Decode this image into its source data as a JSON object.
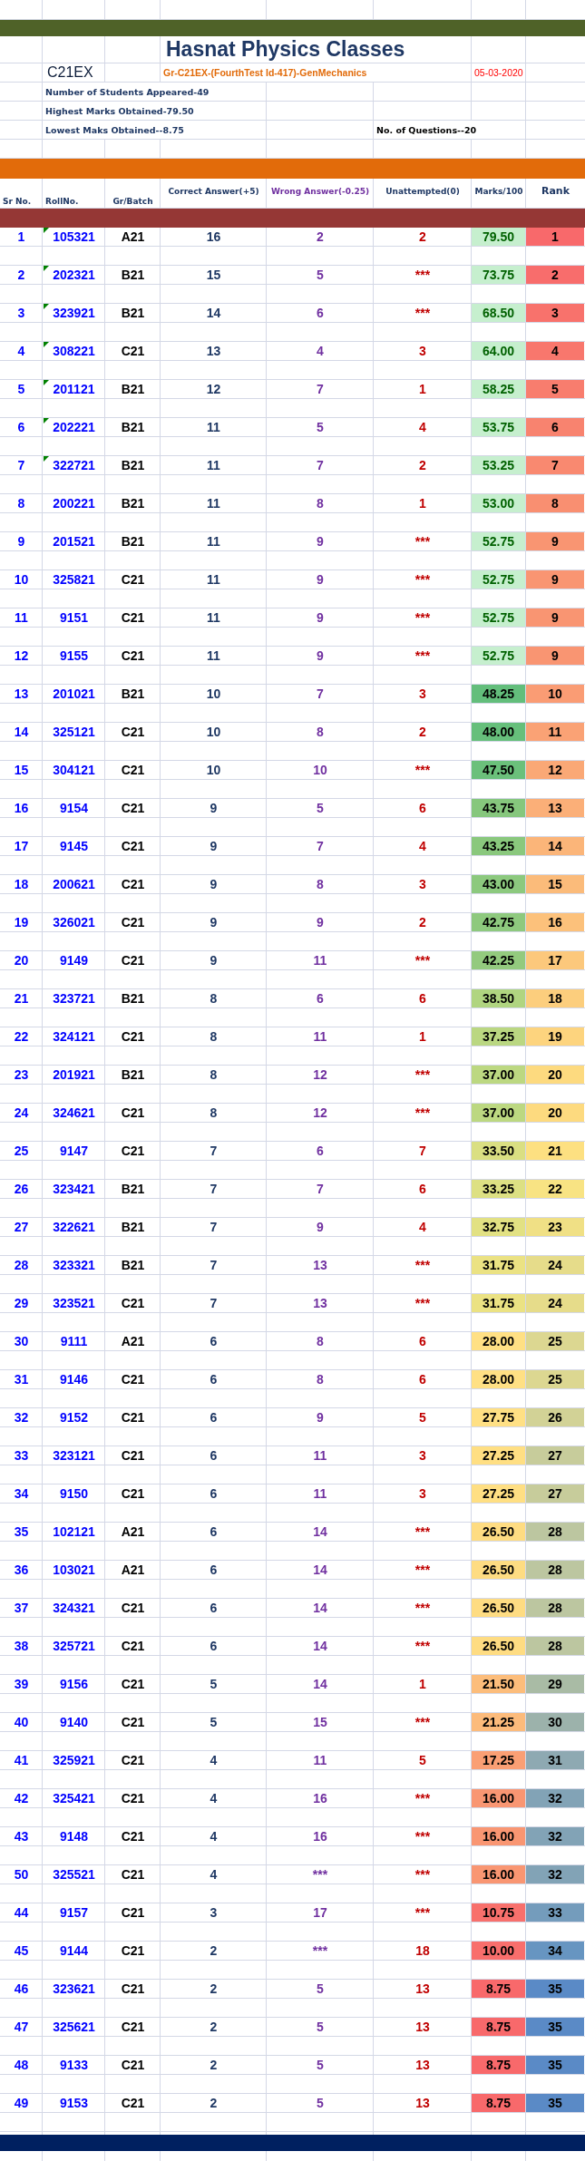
{
  "title": "Hasnat Physics Classes",
  "class_code": "C21EX",
  "test_name": "Gr-C21EX-(FourthTest Id-417)-GenMechanics",
  "date": "05-03-2020",
  "stats": [
    "Number of Students Appeared-49",
    "Highest Marks Obtained-79.50",
    "Lowest Maks Obtained--8.75"
  ],
  "questions": "No. of Questions--20",
  "columns": [
    "Sr No.",
    "RollNo.",
    "Gr/Batch",
    "Correct Answer(+5)",
    "Wrong Answer(-0.25)",
    "Unattempted(0)",
    "Marks/100",
    "Rank"
  ],
  "rows": [
    {
      "sr": "1",
      "roll": "105321",
      "batch": "A21",
      "correct": "16",
      "wrong": "2",
      "unattempted": "2",
      "marks": {
        "value": "79.50",
        "color": "#c6efce",
        "good": true
      },
      "rank": {
        "value": "1",
        "color": "#f8696b"
      },
      "flagged": true
    },
    {
      "sr": "2",
      "roll": "202321",
      "batch": "B21",
      "correct": "15",
      "wrong": "5",
      "unattempted": "***",
      "marks": {
        "value": "73.75",
        "color": "#c6efce",
        "good": true
      },
      "rank": {
        "value": "2",
        "color": "#f86d6c"
      },
      "flagged": true
    },
    {
      "sr": "3",
      "roll": "323921",
      "batch": "B21",
      "correct": "14",
      "wrong": "6",
      "unattempted": "***",
      "marks": {
        "value": "68.50",
        "color": "#c6efce",
        "good": true
      },
      "rank": {
        "value": "3",
        "color": "#f8726c"
      },
      "flagged": true
    },
    {
      "sr": "4",
      "roll": "308221",
      "batch": "C21",
      "correct": "13",
      "wrong": "4",
      "unattempted": "3",
      "marks": {
        "value": "64.00",
        "color": "#c6efce",
        "good": true
      },
      "rank": {
        "value": "4",
        "color": "#f8776d"
      },
      "flagged": true
    },
    {
      "sr": "5",
      "roll": "201121",
      "batch": "B21",
      "correct": "12",
      "wrong": "7",
      "unattempted": "1",
      "marks": {
        "value": "58.25",
        "color": "#c6efce",
        "good": true
      },
      "rank": {
        "value": "5",
        "color": "#f87d6e"
      },
      "flagged": true
    },
    {
      "sr": "6",
      "roll": "202221",
      "batch": "B21",
      "correct": "11",
      "wrong": "5",
      "unattempted": "4",
      "marks": {
        "value": "53.75",
        "color": "#c6efce",
        "good": true
      },
      "rank": {
        "value": "6",
        "color": "#f8836f"
      },
      "flagged": true
    },
    {
      "sr": "7",
      "roll": "322721",
      "batch": "B21",
      "correct": "11",
      "wrong": "7",
      "unattempted": "2",
      "marks": {
        "value": "53.25",
        "color": "#c6efce",
        "good": true
      },
      "rank": {
        "value": "7",
        "color": "#f98970"
      },
      "flagged": true
    },
    {
      "sr": "8",
      "roll": "200221",
      "batch": "B21",
      "correct": "11",
      "wrong": "8",
      "unattempted": "1",
      "marks": {
        "value": "53.00",
        "color": "#c6efce",
        "good": true
      },
      "rank": {
        "value": "8",
        "color": "#f98f71"
      },
      "flagged": false
    },
    {
      "sr": "9",
      "roll": "201521",
      "batch": "B21",
      "correct": "11",
      "wrong": "9",
      "unattempted": "***",
      "marks": {
        "value": "52.75",
        "color": "#c6efce",
        "good": true
      },
      "rank": {
        "value": "9",
        "color": "#f99572"
      },
      "flagged": false
    },
    {
      "sr": "10",
      "roll": "325821",
      "batch": "C21",
      "correct": "11",
      "wrong": "9",
      "unattempted": "***",
      "marks": {
        "value": "52.75",
        "color": "#c6efce",
        "good": true
      },
      "rank": {
        "value": "9",
        "color": "#f99572"
      },
      "flagged": false
    },
    {
      "sr": "11",
      "roll": "9151",
      "batch": "C21",
      "correct": "11",
      "wrong": "9",
      "unattempted": "***",
      "marks": {
        "value": "52.75",
        "color": "#c6efce",
        "good": true
      },
      "rank": {
        "value": "9",
        "color": "#f99572"
      },
      "flagged": false
    },
    {
      "sr": "12",
      "roll": "9155",
      "batch": "C21",
      "correct": "11",
      "wrong": "9",
      "unattempted": "***",
      "marks": {
        "value": "52.75",
        "color": "#c6efce",
        "good": true
      },
      "rank": {
        "value": "9",
        "color": "#f99572"
      },
      "flagged": false
    },
    {
      "sr": "13",
      "roll": "201021",
      "batch": "B21",
      "correct": "10",
      "wrong": "7",
      "unattempted": "3",
      "marks": {
        "value": "48.25",
        "color": "#63be7b",
        "good": false
      },
      "rank": {
        "value": "10",
        "color": "#fa9c74"
      },
      "flagged": false
    },
    {
      "sr": "14",
      "roll": "325121",
      "batch": "C21",
      "correct": "10",
      "wrong": "8",
      "unattempted": "2",
      "marks": {
        "value": "48.00",
        "color": "#66bf7b",
        "good": false
      },
      "rank": {
        "value": "11",
        "color": "#faa275"
      },
      "flagged": false
    },
    {
      "sr": "15",
      "roll": "304121",
      "batch": "C21",
      "correct": "10",
      "wrong": "10",
      "unattempted": "***",
      "marks": {
        "value": "47.50",
        "color": "#6bc07b",
        "good": false
      },
      "rank": {
        "value": "12",
        "color": "#faa876"
      },
      "flagged": false
    },
    {
      "sr": "16",
      "roll": "9154",
      "batch": "C21",
      "correct": "9",
      "wrong": "5",
      "unattempted": "6",
      "marks": {
        "value": "43.75",
        "color": "#86c77d",
        "good": false
      },
      "rank": {
        "value": "13",
        "color": "#fbaf78"
      },
      "flagged": false
    },
    {
      "sr": "17",
      "roll": "9145",
      "batch": "C21",
      "correct": "9",
      "wrong": "7",
      "unattempted": "4",
      "marks": {
        "value": "43.25",
        "color": "#8ac87d",
        "good": false
      },
      "rank": {
        "value": "14",
        "color": "#fbb579"
      },
      "flagged": false
    },
    {
      "sr": "18",
      "roll": "200621",
      "batch": "C21",
      "correct": "9",
      "wrong": "8",
      "unattempted": "3",
      "marks": {
        "value": "43.00",
        "color": "#8cc97e",
        "good": false
      },
      "rank": {
        "value": "15",
        "color": "#fbbb7a"
      },
      "flagged": false
    },
    {
      "sr": "19",
      "roll": "326021",
      "batch": "C21",
      "correct": "9",
      "wrong": "9",
      "unattempted": "2",
      "marks": {
        "value": "42.75",
        "color": "#8ec97e",
        "good": false
      },
      "rank": {
        "value": "16",
        "color": "#fcc17b"
      },
      "flagged": false
    },
    {
      "sr": "20",
      "roll": "9149",
      "batch": "C21",
      "correct": "9",
      "wrong": "11",
      "unattempted": "***",
      "marks": {
        "value": "42.25",
        "color": "#93ca7e",
        "good": false
      },
      "rank": {
        "value": "17",
        "color": "#fcc87c"
      },
      "flagged": false
    },
    {
      "sr": "21",
      "roll": "323721",
      "batch": "B21",
      "correct": "8",
      "wrong": "6",
      "unattempted": "6",
      "marks": {
        "value": "38.50",
        "color": "#b0d580",
        "good": false
      },
      "rank": {
        "value": "18",
        "color": "#fcce7d"
      },
      "flagged": false
    },
    {
      "sr": "22",
      "roll": "324121",
      "batch": "C21",
      "correct": "8",
      "wrong": "11",
      "unattempted": "1",
      "marks": {
        "value": "37.25",
        "color": "#bad781",
        "good": false
      },
      "rank": {
        "value": "19",
        "color": "#fdd47e"
      },
      "flagged": false
    },
    {
      "sr": "23",
      "roll": "201921",
      "batch": "B21",
      "correct": "8",
      "wrong": "12",
      "unattempted": "***",
      "marks": {
        "value": "37.00",
        "color": "#bcd881",
        "good": false
      },
      "rank": {
        "value": "20",
        "color": "#fdda7f"
      },
      "flagged": false
    },
    {
      "sr": "24",
      "roll": "324621",
      "batch": "C21",
      "correct": "8",
      "wrong": "12",
      "unattempted": "***",
      "marks": {
        "value": "37.00",
        "color": "#bcd881",
        "good": false
      },
      "rank": {
        "value": "20",
        "color": "#fdda7f"
      },
      "flagged": false
    },
    {
      "sr": "25",
      "roll": "9147",
      "batch": "C21",
      "correct": "7",
      "wrong": "6",
      "unattempted": "7",
      "marks": {
        "value": "33.50",
        "color": "#dadf82",
        "good": false
      },
      "rank": {
        "value": "21",
        "color": "#fde081"
      },
      "flagged": false
    },
    {
      "sr": "26",
      "roll": "323421",
      "batch": "B21",
      "correct": "7",
      "wrong": "7",
      "unattempted": "6",
      "marks": {
        "value": "33.25",
        "color": "#dde083",
        "good": false
      },
      "rank": {
        "value": "22",
        "color": "#f8e383"
      },
      "flagged": false
    },
    {
      "sr": "27",
      "roll": "322621",
      "batch": "B21",
      "correct": "7",
      "wrong": "9",
      "unattempted": "4",
      "marks": {
        "value": "32.75",
        "color": "#e2e183",
        "good": false
      },
      "rank": {
        "value": "23",
        "color": "#f0e085"
      },
      "flagged": false
    },
    {
      "sr": "28",
      "roll": "323321",
      "batch": "B21",
      "correct": "7",
      "wrong": "13",
      "unattempted": "***",
      "marks": {
        "value": "31.75",
        "color": "#ebe283",
        "good": false
      },
      "rank": {
        "value": "24",
        "color": "#e6dc8a"
      },
      "flagged": false
    },
    {
      "sr": "29",
      "roll": "323521",
      "batch": "C21",
      "correct": "7",
      "wrong": "13",
      "unattempted": "***",
      "marks": {
        "value": "31.75",
        "color": "#ebe283",
        "good": false
      },
      "rank": {
        "value": "24",
        "color": "#e6dc8a"
      },
      "flagged": false
    },
    {
      "sr": "30",
      "roll": "9111",
      "batch": "A21",
      "correct": "6",
      "wrong": "8",
      "unattempted": "6",
      "marks": {
        "value": "28.00",
        "color": "#ffe084",
        "good": false
      },
      "rank": {
        "value": "25",
        "color": "#dcd791"
      },
      "flagged": false
    },
    {
      "sr": "31",
      "roll": "9146",
      "batch": "C21",
      "correct": "6",
      "wrong": "8",
      "unattempted": "6",
      "marks": {
        "value": "28.00",
        "color": "#ffe084",
        "good": false
      },
      "rank": {
        "value": "25",
        "color": "#dcd791"
      },
      "flagged": false
    },
    {
      "sr": "32",
      "roll": "9152",
      "batch": "C21",
      "correct": "6",
      "wrong": "9",
      "unattempted": "5",
      "marks": {
        "value": "27.75",
        "color": "#ffe084",
        "good": false
      },
      "rank": {
        "value": "26",
        "color": "#d2d296"
      },
      "flagged": false
    },
    {
      "sr": "33",
      "roll": "323121",
      "batch": "C21",
      "correct": "6",
      "wrong": "11",
      "unattempted": "3",
      "marks": {
        "value": "27.25",
        "color": "#ffdf83",
        "good": false
      },
      "rank": {
        "value": "27",
        "color": "#c7cc9b"
      },
      "flagged": false
    },
    {
      "sr": "34",
      "roll": "9150",
      "batch": "C21",
      "correct": "6",
      "wrong": "11",
      "unattempted": "3",
      "marks": {
        "value": "27.25",
        "color": "#ffdf83",
        "good": false
      },
      "rank": {
        "value": "27",
        "color": "#c7cc9b"
      },
      "flagged": false
    },
    {
      "sr": "35",
      "roll": "102121",
      "batch": "A21",
      "correct": "6",
      "wrong": "14",
      "unattempted": "***",
      "marks": {
        "value": "26.50",
        "color": "#fedc82",
        "good": false
      },
      "rank": {
        "value": "28",
        "color": "#bcc6a0"
      },
      "flagged": false
    },
    {
      "sr": "36",
      "roll": "103021",
      "batch": "A21",
      "correct": "6",
      "wrong": "14",
      "unattempted": "***",
      "marks": {
        "value": "26.50",
        "color": "#fedc82",
        "good": false
      },
      "rank": {
        "value": "28",
        "color": "#bcc6a0"
      },
      "flagged": false
    },
    {
      "sr": "37",
      "roll": "324321",
      "batch": "C21",
      "correct": "6",
      "wrong": "14",
      "unattempted": "***",
      "marks": {
        "value": "26.50",
        "color": "#fedc82",
        "good": false
      },
      "rank": {
        "value": "28",
        "color": "#bcc6a0"
      },
      "flagged": false
    },
    {
      "sr": "38",
      "roll": "325721",
      "batch": "C21",
      "correct": "6",
      "wrong": "14",
      "unattempted": "***",
      "marks": {
        "value": "26.50",
        "color": "#fedc82",
        "good": false
      },
      "rank": {
        "value": "28",
        "color": "#bcc6a0"
      },
      "flagged": false
    },
    {
      "sr": "39",
      "roll": "9156",
      "batch": "C21",
      "correct": "5",
      "wrong": "14",
      "unattempted": "1",
      "marks": {
        "value": "21.50",
        "color": "#fcbd7b",
        "good": false
      },
      "rank": {
        "value": "29",
        "color": "#a9bba5"
      },
      "flagged": false
    },
    {
      "sr": "40",
      "roll": "9140",
      "batch": "C21",
      "correct": "5",
      "wrong": "15",
      "unattempted": "***",
      "marks": {
        "value": "21.25",
        "color": "#fcbb7b",
        "good": false
      },
      "rank": {
        "value": "30",
        "color": "#9cb2ab"
      },
      "flagged": false
    },
    {
      "sr": "41",
      "roll": "325921",
      "batch": "C21",
      "correct": "4",
      "wrong": "11",
      "unattempted": "5",
      "marks": {
        "value": "17.25",
        "color": "#fa9f74",
        "good": false
      },
      "rank": {
        "value": "31",
        "color": "#8ea9b2"
      },
      "flagged": false
    },
    {
      "sr": "42",
      "roll": "325421",
      "batch": "C21",
      "correct": "4",
      "wrong": "16",
      "unattempted": "***",
      "marks": {
        "value": "16.00",
        "color": "#f99672",
        "good": false
      },
      "rank": {
        "value": "32",
        "color": "#82a3b6"
      },
      "flagged": false
    },
    {
      "sr": "43",
      "roll": "9148",
      "batch": "C21",
      "correct": "4",
      "wrong": "16",
      "unattempted": "***",
      "marks": {
        "value": "16.00",
        "color": "#f99672",
        "good": false
      },
      "rank": {
        "value": "32",
        "color": "#82a3b6"
      },
      "flagged": false
    },
    {
      "sr": "50",
      "roll": "325521",
      "batch": "C21",
      "correct": "4",
      "wrong": "***",
      "unattempted": "***",
      "marks": {
        "value": "16.00",
        "color": "#f99672",
        "good": false
      },
      "rank": {
        "value": "32",
        "color": "#82a3b6"
      },
      "flagged": false
    },
    {
      "sr": "44",
      "roll": "9157",
      "batch": "C21",
      "correct": "3",
      "wrong": "17",
      "unattempted": "***",
      "marks": {
        "value": "10.75",
        "color": "#f8706c",
        "good": false
      },
      "rank": {
        "value": "33",
        "color": "#749cbc"
      },
      "flagged": false
    },
    {
      "sr": "45",
      "roll": "9144",
      "batch": "C21",
      "correct": "2",
      "wrong": "***",
      "unattempted": "18",
      "marks": {
        "value": "10.00",
        "color": "#f86e6c",
        "good": false
      },
      "rank": {
        "value": "34",
        "color": "#6795c1"
      },
      "flagged": false
    },
    {
      "sr": "46",
      "roll": "323621",
      "batch": "C21",
      "correct": "2",
      "wrong": "5",
      "unattempted": "13",
      "marks": {
        "value": "8.75",
        "color": "#f8696b",
        "good": false
      },
      "rank": {
        "value": "35",
        "color": "#5a8ac6"
      },
      "flagged": false
    },
    {
      "sr": "47",
      "roll": "325621",
      "batch": "C21",
      "correct": "2",
      "wrong": "5",
      "unattempted": "13",
      "marks": {
        "value": "8.75",
        "color": "#f8696b",
        "good": false
      },
      "rank": {
        "value": "35",
        "color": "#5a8ac6"
      },
      "flagged": false
    },
    {
      "sr": "48",
      "roll": "9133",
      "batch": "C21",
      "correct": "2",
      "wrong": "5",
      "unattempted": "13",
      "marks": {
        "value": "8.75",
        "color": "#f8696b",
        "good": false
      },
      "rank": {
        "value": "35",
        "color": "#5a8ac6"
      },
      "flagged": false
    },
    {
      "sr": "49",
      "roll": "9153",
      "batch": "C21",
      "correct": "2",
      "wrong": "5",
      "unattempted": "13",
      "marks": {
        "value": "8.75",
        "color": "#f8696b",
        "good": false
      },
      "rank": {
        "value": "35",
        "color": "#5a8ac6"
      },
      "flagged": false
    }
  ]
}
